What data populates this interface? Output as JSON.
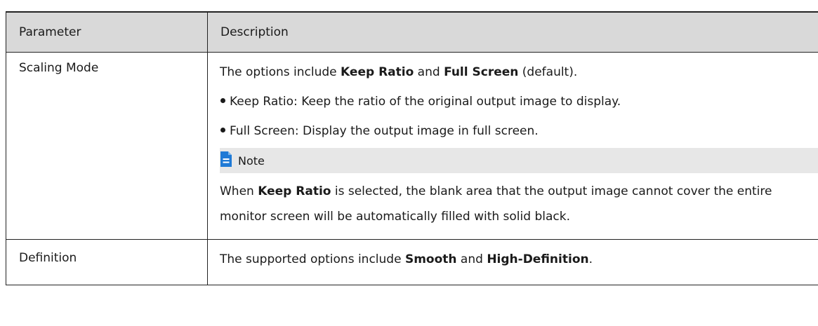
{
  "table": {
    "headers": {
      "parameter": "Parameter",
      "description": "Description"
    },
    "rows": [
      {
        "parameter": "Scaling Mode",
        "intro": {
          "pre": "The options include ",
          "b1": "Keep Ratio",
          "mid": " and ",
          "b2": "Full Screen",
          "post": " (default)."
        },
        "bullets": [
          "Keep Ratio: Keep the ratio of the original output image to display.",
          "Full Screen: Display the output image in full screen."
        ],
        "note": {
          "label": "Note",
          "pre": "When ",
          "bold": "Keep Ratio",
          "post": " is selected, the blank area that the output image cannot cover the entire monitor screen will be automatically filled with solid black."
        }
      },
      {
        "parameter": "Definition",
        "intro": {
          "pre": "The supported options include ",
          "b1": "Smooth",
          "mid": " and ",
          "b2": "High-Definition",
          "post": "."
        }
      }
    ]
  },
  "colors": {
    "header_bg": "#d9d9d9",
    "note_bg": "#e7e7e7",
    "note_icon": "#1f7ad6",
    "border": "#222222"
  },
  "icons": {
    "note": "note-document-icon"
  }
}
